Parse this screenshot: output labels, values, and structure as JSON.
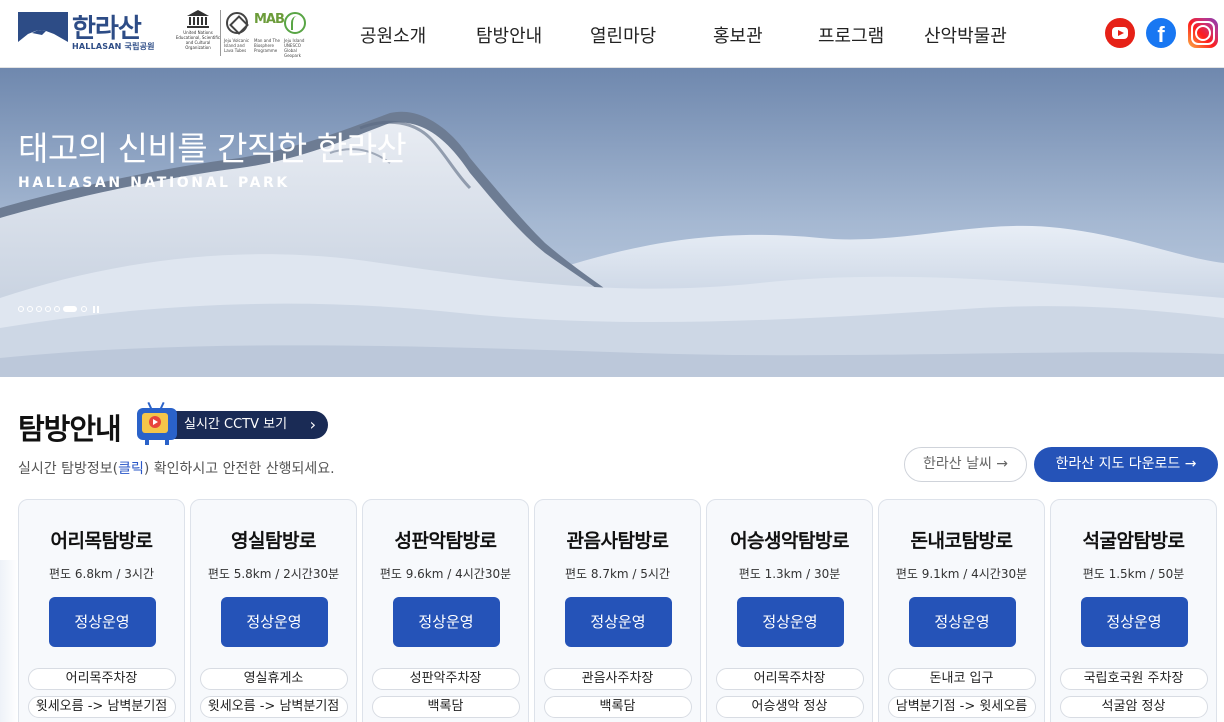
{
  "header": {
    "logo": {
      "korean": "한라산",
      "english": "HALLASAN 국립공원"
    },
    "partners": {
      "unesco": "United Nations Educational, Scientific and Cultural Organization",
      "whs": "Jeju Volcanic Island and Lava Tubes",
      "mab": "MAB",
      "mab_sub": "Man and The Biosphere Programme",
      "geo_sub": "Jeju Island UNESCO Global Geopark"
    },
    "nav": [
      "공원소개",
      "탐방안내",
      "열린마당",
      "홍보관",
      "프로그램",
      "산악박물관"
    ],
    "social": {
      "youtube": "youtube-icon",
      "facebook": "f",
      "instagram": "instagram-icon"
    }
  },
  "hero": {
    "title": "태고의 신비를 간직한 한라산",
    "subtitle": "HALLASAN NATIONAL PARK",
    "slide_count": 7,
    "active_slide": 6
  },
  "info": {
    "title": "탐방안내",
    "cctv_button": "실시간 CCTV 보기",
    "desc_before": "실시간 탐방정보(",
    "desc_link": "클릭",
    "desc_after": ") 확인하시고 안전한 산행되세요.",
    "weather_button": "한라산 날씨 →",
    "map_button": "한라산 지도 다운로드 →"
  },
  "trails": [
    {
      "name": "어리목탐방로",
      "meta": "편도 6.8km / 3시간",
      "status": "정상운영",
      "info1": "어리목주차장",
      "info2": "윗세오름 -> 남벽분기점"
    },
    {
      "name": "영실탐방로",
      "meta": "편도 5.8km / 2시간30분",
      "status": "정상운영",
      "info1": "영실휴게소",
      "info2": "윗세오름 -> 남벽분기점"
    },
    {
      "name": "성판악탐방로",
      "meta": "편도 9.6km / 4시간30분",
      "status": "정상운영",
      "info1": "성판악주차장",
      "info2": "백록담"
    },
    {
      "name": "관음사탐방로",
      "meta": "편도 8.7km / 5시간",
      "status": "정상운영",
      "info1": "관음사주차장",
      "info2": "백록담"
    },
    {
      "name": "어승생악탐방로",
      "meta": "편도 1.3km / 30분",
      "status": "정상운영",
      "info1": "어리목주차장",
      "info2": "어승생악 정상"
    },
    {
      "name": "돈내코탐방로",
      "meta": "편도 9.1km / 4시간30분",
      "status": "정상운영",
      "info1": "돈내코 입구",
      "info2": "남벽분기점 -> 윗세오름"
    },
    {
      "name": "석굴암탐방로",
      "meta": "편도 1.5km / 50분",
      "status": "정상운영",
      "info1": "국립호국원 주차장",
      "info2": "석굴암 정상"
    }
  ],
  "colors": {
    "brand": "#2d4c86",
    "accent": "#2553b8",
    "cctv_bg": "#1a2b55"
  }
}
